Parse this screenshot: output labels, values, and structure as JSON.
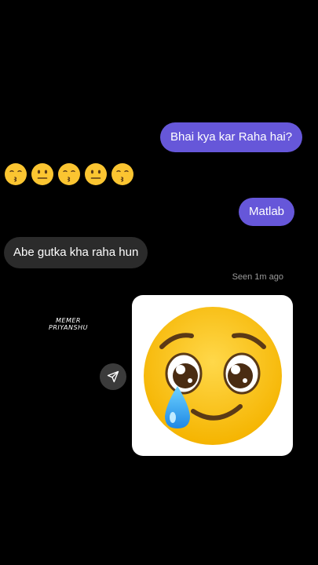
{
  "conversation": {
    "messages": [
      {
        "sender": "me",
        "text": "Bhai kya kar Raha hai?"
      },
      {
        "sender": "them",
        "emoji_sequence": [
          "kissing-face",
          "neutral-face",
          "kissing-face",
          "neutral-face",
          "kissing-face"
        ]
      },
      {
        "sender": "me",
        "text": "Matlab"
      },
      {
        "sender": "them",
        "text": "Abe gutka kha raha hun"
      }
    ],
    "seen_status": "Seen 1m ago",
    "attachment": {
      "type": "image",
      "icon": "face-holding-back-tears-icon"
    },
    "share_icon": "send-arrow-icon"
  },
  "watermark": {
    "line1": "MEMER",
    "line2": "PRIYANSHU"
  },
  "colors": {
    "background": "#000000",
    "sent_bubble": "#6657d9",
    "received_bubble": "#2b2b2b",
    "seen_text": "#9a9a9a",
    "emoji_yellow": "#fbc531"
  }
}
